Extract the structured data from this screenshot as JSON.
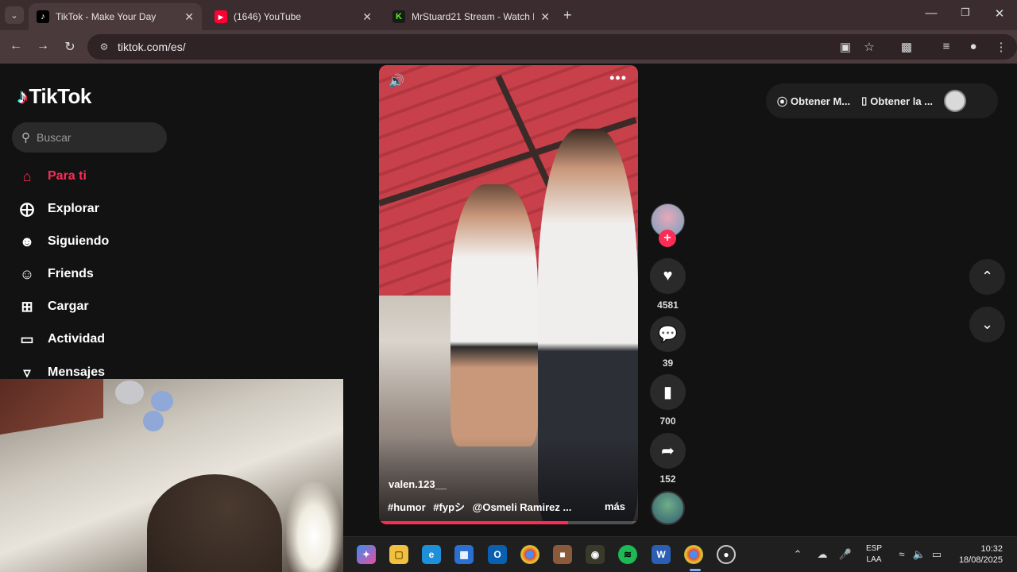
{
  "browser": {
    "tabs": [
      {
        "title": "TikTok - Make Your Day",
        "favicon": "tiktok-icon",
        "active": true
      },
      {
        "title": "(1646) YouTube",
        "favicon": "youtube-icon",
        "active": false
      },
      {
        "title": "MrStuard21 Stream - Watch Liv",
        "favicon": "kick-icon",
        "active": false
      }
    ],
    "url": "tiktok.com/es/"
  },
  "tiktok": {
    "logo_text": "TikTok",
    "search_placeholder": "Buscar",
    "nav": [
      {
        "label": "Para ti",
        "icon": "home-icon",
        "active": true
      },
      {
        "label": "Explorar",
        "icon": "compass-icon",
        "active": false
      },
      {
        "label": "Siguiendo",
        "icon": "following-icon",
        "active": false
      },
      {
        "label": "Friends",
        "icon": "friends-icon",
        "active": false
      },
      {
        "label": "Cargar",
        "icon": "upload-icon",
        "active": false
      },
      {
        "label": "Actividad",
        "icon": "activity-icon",
        "active": false
      },
      {
        "label": "Mensajes",
        "icon": "messages-icon",
        "active": false
      }
    ],
    "video": {
      "author": "valen.123__",
      "hashtags": [
        "#humor",
        "#fypシ",
        "@Osmeli Ramirez ..."
      ],
      "more_label": "más",
      "progress": 0.73
    },
    "actions": {
      "likes": "4581",
      "comments": "39",
      "saves": "700",
      "shares": "152"
    },
    "top_right": {
      "get_app_label": "Obtener M...",
      "get_desktop_label": "Obtener la ..."
    }
  },
  "taskbar": {
    "language_line1": "ESP",
    "language_line2": "LAA",
    "time": "10:32",
    "date": "18/08/2025"
  },
  "colors": {
    "accent": "#fe2c55",
    "chrome_tab_bg": "#3b2d2f",
    "page_bg": "#121212"
  }
}
